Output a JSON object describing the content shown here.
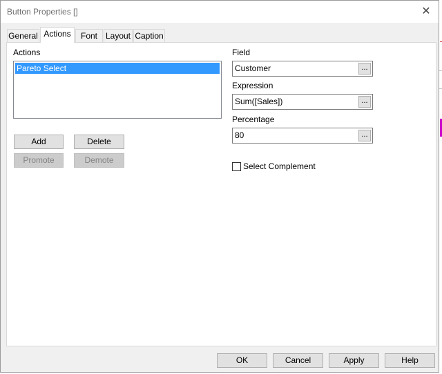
{
  "window": {
    "title": "Button Properties []"
  },
  "tabs": [
    "General",
    "Actions",
    "Font",
    "Layout",
    "Caption"
  ],
  "active_tab": "Actions",
  "actions": {
    "label": "Actions",
    "items": [
      "Pareto Select"
    ],
    "add_label": "Add",
    "delete_label": "Delete",
    "promote_label": "Promote",
    "demote_label": "Demote"
  },
  "field": {
    "label": "Field",
    "value": "Customer"
  },
  "expression": {
    "label": "Expression",
    "value": "Sum([Sales])"
  },
  "percentage": {
    "label": "Percentage",
    "value": "80"
  },
  "ellipsis": "...",
  "select_complement": {
    "label": "Select Complement",
    "checked": false
  },
  "footer": {
    "ok": "OK",
    "cancel": "Cancel",
    "apply": "Apply",
    "help": "Help"
  },
  "colors": {
    "selection": "#3399ff",
    "background": "#f0f0f0"
  }
}
